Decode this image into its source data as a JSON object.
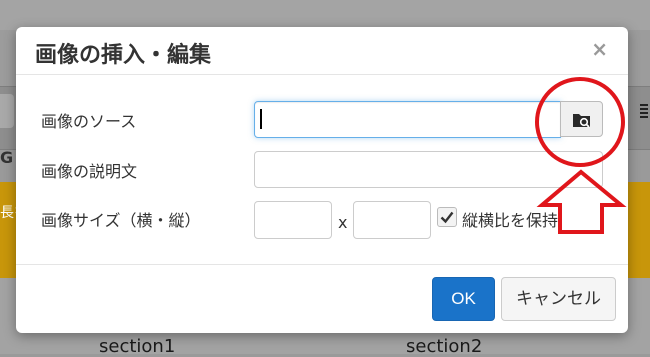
{
  "background": {
    "left_fragment": "長を",
    "left_fragment2": "G",
    "section_labels": [
      "section1",
      "section2"
    ]
  },
  "dialog": {
    "title": "画像の挿入・編集",
    "close_label": "×",
    "fields": {
      "source": {
        "label": "画像のソース",
        "value": ""
      },
      "description": {
        "label": "画像の説明文",
        "value": ""
      },
      "size": {
        "label": "画像サイズ（横・縦）",
        "width_value": "",
        "height_value": "",
        "separator": "x"
      }
    },
    "browse_icon": "folder-search-icon",
    "keep_ratio": {
      "label": "縦横比を保持",
      "checked": true
    },
    "buttons": {
      "ok": "OK",
      "cancel": "キャンセル"
    }
  },
  "colors": {
    "primary_button": "#1a73c9",
    "annotation": "#e0161b",
    "overlay_yellow": "#c8960a"
  }
}
